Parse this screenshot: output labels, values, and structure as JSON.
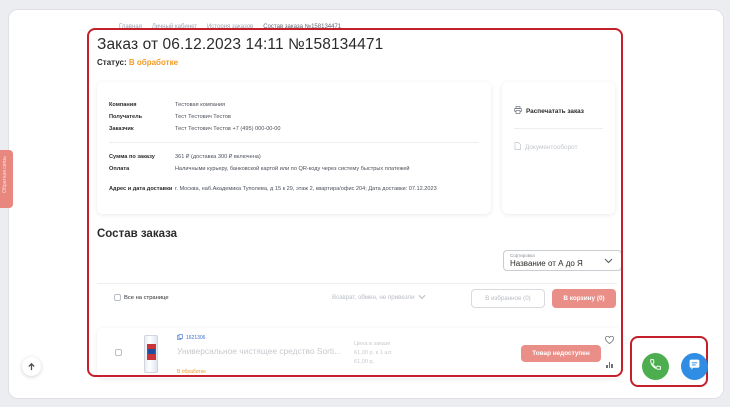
{
  "breadcrumb": [
    "Главная",
    "Личный кабинет",
    "История заказов",
    "Состав заказа №158134471"
  ],
  "side_tab_label": "Обратная связь",
  "order": {
    "title": "Заказ от 06.12.2023 14:11 №158134471",
    "status_label": "Статус:",
    "status_value": "В обработке",
    "status_color": "#f19b25"
  },
  "info": {
    "company_label": "Компания",
    "company_value": "Тестовая компания",
    "recipient_label": "Получатель",
    "recipient_value": "Тест Тестович Тестов",
    "customer_label": "Заказчик",
    "customer_value": "Тест Тестович Тестов +7 (495) 000-00-00",
    "sum_label": "Сумма по заказу",
    "sum_value": "361 ₽ (доставка 300 ₽ включена)",
    "payment_label": "Оплата",
    "payment_value": "Наличными курьеру, банковской картой или по QR-коду через систему быстрых платежей",
    "address_label": "Адрес и дата доставки",
    "address_value": "г. Москва, наб.Академика Туполева, д 15 к 29, этаж 2, квартира/офис 204; Дата доставки: 07.12.2023"
  },
  "side_actions": {
    "print": "Распечатать заказ",
    "docs": "Документооборот"
  },
  "composition": {
    "title": "Состав заказа",
    "sort_label": "Сортировка",
    "sort_value": "Название от А до Я",
    "select_all": "Все на странице",
    "returns": "Возврат, обмен, не привезли",
    "to_favorites": "В избранное (0)",
    "to_cart": "В корзину (0)"
  },
  "product": {
    "sku": "1621306",
    "name": "Универсальное чистящее средство Sorti...",
    "status": "В обработке",
    "price_label": "Цена в заказе",
    "price_value": "61,00 р. к 1 шт.",
    "price_total": "61,00 р.",
    "unavailable": "Товар недоступен"
  },
  "colors": {
    "accent_orange": "#f19b25",
    "highlight_red": "#c4202b",
    "button_pink": "#ea8e88",
    "phone_green": "#4cae4e",
    "chat_blue": "#2f8de4"
  },
  "icons": [
    "printer-icon",
    "document-icon",
    "copy-icon",
    "chevron-down-icon",
    "heart-icon",
    "bar-chart-icon",
    "arrow-up-icon",
    "phone-icon",
    "chat-icon"
  ]
}
